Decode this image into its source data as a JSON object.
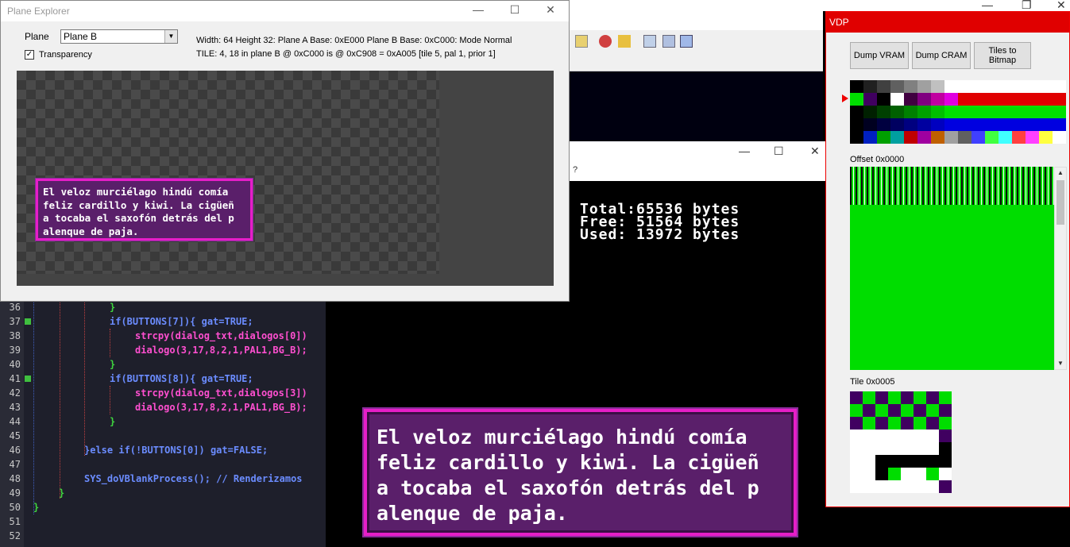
{
  "plane_explorer": {
    "title": "Plane Explorer",
    "plane_label": "Plane",
    "plane_value": "Plane B",
    "transparency_label": "Transparency",
    "transparency_checked": true,
    "info_line1": "Width: 64 Height 32: Plane A Base: 0xE000 Plane B Base: 0xC000: Mode Normal",
    "info_line2": "TILE: 4, 18 in plane B @ 0xC000 is @ 0xC908 = 0xA005 [tile 5, pal 1, prior 1]",
    "preview_text": "El veloz murciélago hindú comía\nfeliz cardillo y kiwi. La cigüeñ\na tocaba el saxofón detrás del p\nalenque de paja."
  },
  "memory_window": {
    "help_mark": "?",
    "text": "Total:65536 bytes\nFree: 51564 bytes\nUsed: 13972 bytes"
  },
  "game_text": "El veloz murciélago hindú comía\nfeliz cardillo y kiwi. La cigüeñ\na tocaba el saxofón detrás del p\nalenque de paja.",
  "code_editor": {
    "lines": [
      {
        "num": "36",
        "code": "}"
      },
      {
        "num": "37",
        "code": "if(BUTTONS[7]){ gat=TRUE;"
      },
      {
        "num": "38",
        "code": "strcpy(dialog_txt,dialogos[0])"
      },
      {
        "num": "39",
        "code": "dialogo(3,17,8,2,1,PAL1,BG_B);"
      },
      {
        "num": "40",
        "code": "}"
      },
      {
        "num": "41",
        "code": "if(BUTTONS[8]){ gat=TRUE;"
      },
      {
        "num": "42",
        "code": "strcpy(dialog_txt,dialogos[3])"
      },
      {
        "num": "43",
        "code": "dialogo(3,17,8,2,1,PAL1,BG_B);"
      },
      {
        "num": "44",
        "code": "}"
      },
      {
        "num": "45",
        "code": ""
      },
      {
        "num": "46",
        "code": "}else if(!BUTTONS[0]) gat=FALSE;"
      },
      {
        "num": "47",
        "code": ""
      },
      {
        "num": "48",
        "code": "SYS_doVBlankProcess(); // Renderizamos"
      },
      {
        "num": "49",
        "code": "}"
      },
      {
        "num": "50",
        "code": "}"
      },
      {
        "num": "51",
        "code": ""
      },
      {
        "num": "52",
        "code": ""
      }
    ]
  },
  "vdp": {
    "title": "VDP",
    "dump_vram_label": "Dump VRAM",
    "dump_cram_label": "Dump CRAM",
    "tiles_to_bitmap_label": "Tiles to\nBitmap",
    "offset_label": "Offset 0x0000",
    "tile_label": "Tile 0x0005",
    "cram_rows": [
      [
        "#000000",
        "#202020",
        "#404040",
        "#606060",
        "#808080",
        "#a0a0a0",
        "#c0c0c0",
        "#ffffff",
        "#ffffff",
        "#ffffff",
        "#ffffff",
        "#ffffff",
        "#ffffff",
        "#ffffff",
        "#ffffff",
        "#ffffff"
      ],
      [
        "#00dd00",
        "#400060",
        "#000000",
        "#ffffff",
        "#400040",
        "#800080",
        "#c000a0",
        "#e000e0",
        "#e00000",
        "#e00000",
        "#e00000",
        "#e00000",
        "#e00000",
        "#e00000",
        "#e00000",
        "#e00000"
      ],
      [
        "#000000",
        "#002000",
        "#004000",
        "#006000",
        "#008000",
        "#00a000",
        "#00c000",
        "#00e000",
        "#00e000",
        "#00e000",
        "#00e000",
        "#00e000",
        "#00e000",
        "#00e000",
        "#00e000",
        "#00e000"
      ],
      [
        "#000000",
        "#000020",
        "#000040",
        "#000060",
        "#000080",
        "#0000a0",
        "#0000c0",
        "#0000e0",
        "#0000e0",
        "#0000e0",
        "#0000e0",
        "#0000e0",
        "#0000e0",
        "#0000e0",
        "#0000e0",
        "#0000e0"
      ],
      [
        "#000000",
        "#0020c0",
        "#00a000",
        "#00a0a0",
        "#c00000",
        "#a000a0",
        "#c06000",
        "#a0a0a0",
        "#606060",
        "#4040ff",
        "#40ff40",
        "#40ffff",
        "#ff4040",
        "#ff40ff",
        "#ffff40",
        "#ffffff"
      ]
    ],
    "tile_pixels": [
      [
        "#400060",
        "#00dd00",
        "#400060",
        "#00dd00",
        "#400060",
        "#00dd00",
        "#400060",
        "#00dd00"
      ],
      [
        "#00dd00",
        "#400060",
        "#00dd00",
        "#400060",
        "#00dd00",
        "#400060",
        "#00dd00",
        "#400060"
      ],
      [
        "#400060",
        "#00dd00",
        "#400060",
        "#00dd00",
        "#400060",
        "#00dd00",
        "#400060",
        "#00dd00"
      ],
      [
        "#ffffff",
        "#ffffff",
        "#ffffff",
        "#ffffff",
        "#ffffff",
        "#ffffff",
        "#ffffff",
        "#400060"
      ],
      [
        "#ffffff",
        "#ffffff",
        "#ffffff",
        "#ffffff",
        "#ffffff",
        "#ffffff",
        "#ffffff",
        "#000000"
      ],
      [
        "#ffffff",
        "#ffffff",
        "#000000",
        "#000000",
        "#000000",
        "#000000",
        "#000000",
        "#000000"
      ],
      [
        "#ffffff",
        "#ffffff",
        "#000000",
        "#00dd00",
        "#ffffff",
        "#ffffff",
        "#00dd00",
        "#ffffff"
      ],
      [
        "#ffffff",
        "#ffffff",
        "#ffffff",
        "#ffffff",
        "#ffffff",
        "#ffffff",
        "#ffffff",
        "#400060"
      ]
    ]
  }
}
